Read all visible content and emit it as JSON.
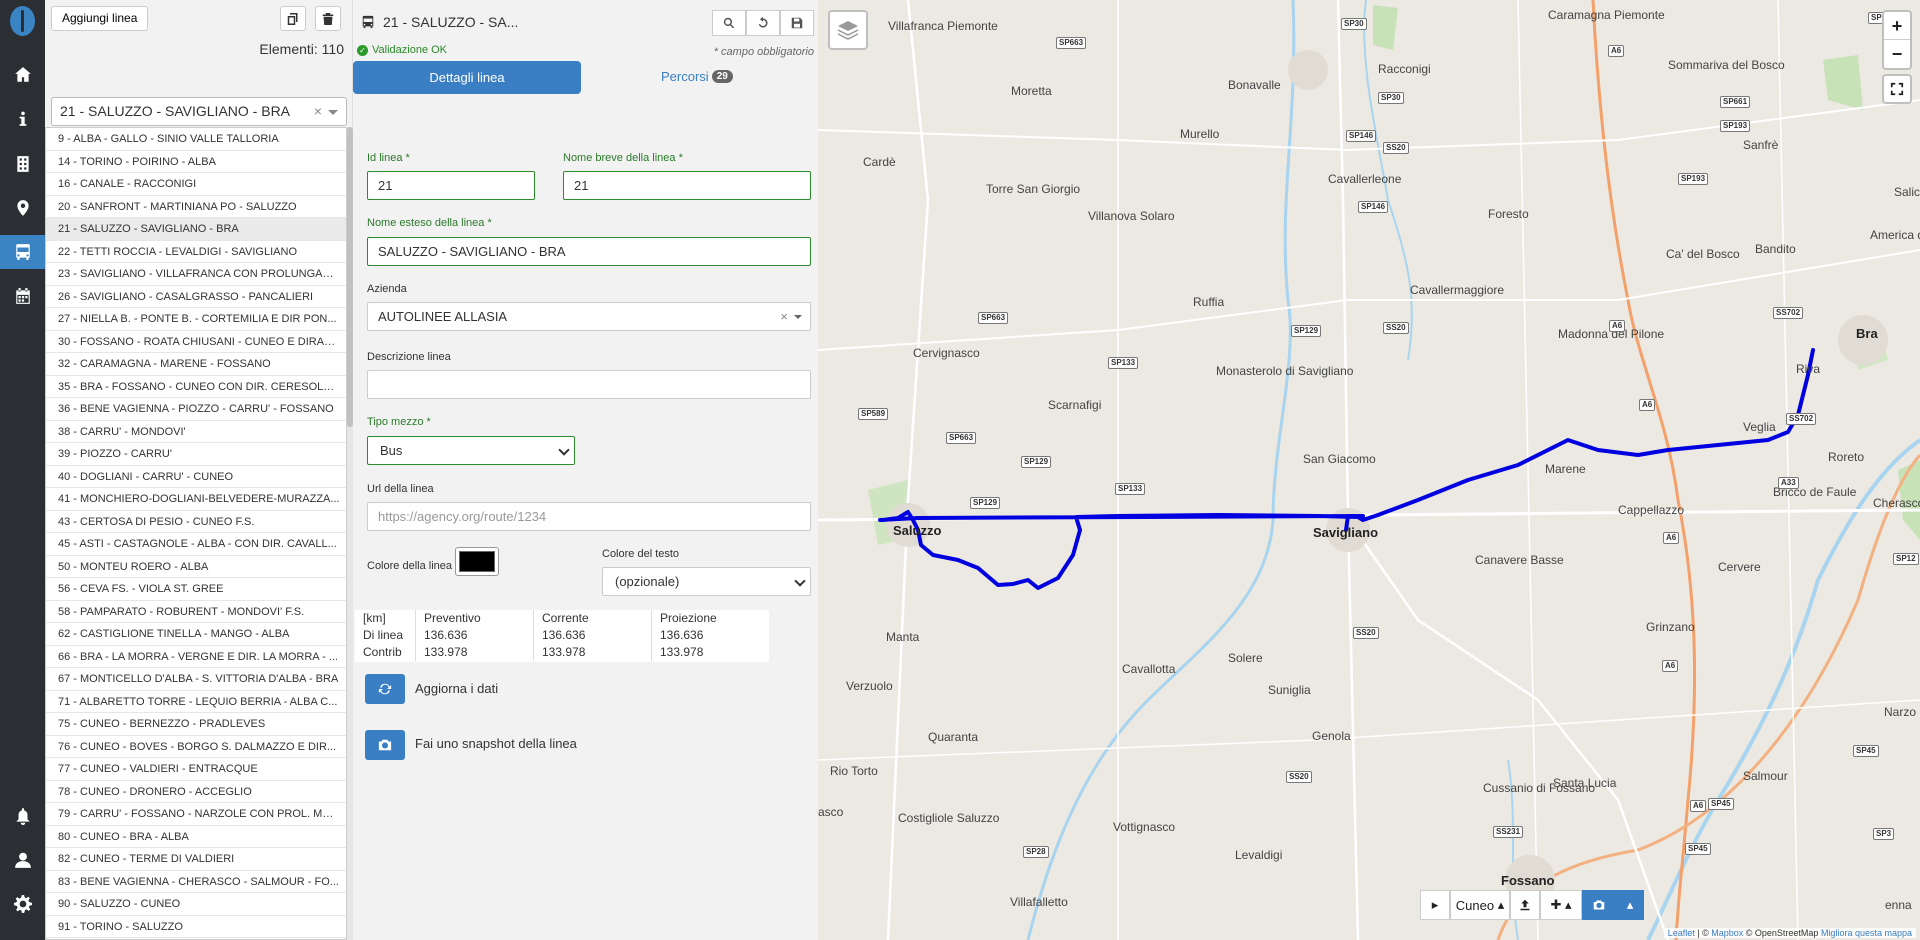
{
  "sidebar": {
    "items": [
      {
        "icon": "home-icon"
      },
      {
        "icon": "info-icon"
      },
      {
        "icon": "building-icon"
      },
      {
        "icon": "map-marker-icon"
      },
      {
        "icon": "bus-icon",
        "active": true
      },
      {
        "icon": "calendar-icon"
      },
      {
        "icon": "bell-icon"
      },
      {
        "icon": "user-icon"
      },
      {
        "icon": "gear-icon"
      }
    ]
  },
  "list": {
    "add_label": "Aggiungi linea",
    "count_label": "Elementi: 110",
    "selected": "21 - SALUZZO - SAVIGLIANO - BRA",
    "clear": "×",
    "items": [
      "9 - ALBA - GALLO - SINIO VALLE TALLORIA",
      "14 - TORINO - POIRINO - ALBA",
      "16 - CANALE - RACCONIGI",
      "20 - SANFRONT - MARTINIANA PO - SALUZZO",
      "21 - SALUZZO - SAVIGLIANO - BRA",
      "22 - TETTI ROCCIA - LEVALDIGI - SAVIGLIANO",
      "23 - SAVIGLIANO - VILLAFRANCA CON PROLUNGAM...",
      "26 - SAVIGLIANO - CASALGRASSO - PANCALIERI",
      "27 - NIELLA B. - PONTE B. - CORTEMILIA E DIR PON...",
      "30 - FOSSANO - ROATA CHIUSANI - CUNEO E DIRAM...",
      "32 - CARAMAGNA - MARENE - FOSSANO",
      "35 - BRA - FOSSANO - CUNEO CON DIR. CERESOLE ...",
      "36 - BENE VAGIENNA - PIOZZO - CARRU' - FOSSANO",
      "38 - CARRU' - MONDOVI'",
      "39 - PIOZZO - CARRU'",
      "40 - DOGLIANI - CARRU' - CUNEO",
      "41 - MONCHIERO-DOGLIANI-BELVEDERE-MURAZZA...",
      "43 - CERTOSA DI PESIO - CUNEO F.S.",
      "45 - ASTI - CASTAGNOLE - ALBA - CON DIR. CAVALL...",
      "50 - MONTEU ROERO - ALBA",
      "56 - CEVA FS. - VIOLA ST. GREE",
      "58 - PAMPARATO - ROBURENT - MONDOVI' F.S.",
      "62 - CASTIGLIONE TINELLA - MANGO - ALBA",
      "66 - BRA - LA MORRA - VERGNE E DIR. LA MORRA - ...",
      "67 - MONTICELLO D'ALBA - S. VITTORIA D'ALBA - BRA",
      "71 - ALBARETTO TORRE - LEQUIO BERRIA - ALBA C...",
      "75 - CUNEO - BERNEZZO - PRADLEVES",
      "76 - CUNEO - BOVES - BORGO S. DALMAZZO E DIR...",
      "77 - CUNEO - VALDIERI - ENTRACQUE",
      "78 - CUNEO - DRONERO - ACCEGLIO",
      "79 - CARRU' - FOSSANO - NARZOLE CON PROL. MO...",
      "80 - CUNEO - BRA - ALBA",
      "82 - CUNEO - TERME DI VALDIERI",
      "83 - BENE VAGIENNA - CHERASCO - SALMOUR - FO...",
      "90 - SALUZZO - CUNEO",
      "91 - TORINO - SALUZZO"
    ]
  },
  "detail": {
    "title": "21 - SALUZZO - SA...",
    "validation": "Validazione OK",
    "required_note": "* campo obbligatorio",
    "tab_details": "Dettagli linea",
    "tab_routes": "Percorsi",
    "routes_count": "29",
    "id_label": "Id linea *",
    "id_value": "21",
    "short_label": "Nome breve della linea *",
    "short_value": "21",
    "long_label": "Nome esteso della linea *",
    "long_value": "SALUZZO - SAVIGLIANO - BRA",
    "agency_label": "Azienda",
    "agency_value": "AUTOLINEE ALLASIA",
    "desc_label": "Descrizione linea",
    "desc_value": "",
    "vehicle_label": "Tipo mezzo *",
    "vehicle_value": "Bus",
    "url_label": "Url della linea",
    "url_placeholder": "https://agency.org/route/1234",
    "color_label": "Colore della linea",
    "line_color": "#000000",
    "textcolor_label": "Colore del testo",
    "textcolor_value": "(opzionale)",
    "stats": {
      "headers": [
        "[km]",
        "Preventivo",
        "Corrente",
        "Proiezione"
      ],
      "rows": [
        [
          "Di linea",
          "136.636",
          "136.636",
          "136.636"
        ],
        [
          "Contrib",
          "133.978",
          "133.978",
          "133.978"
        ]
      ]
    },
    "refresh_label": "Aggiorna i dati",
    "snapshot_label": "Fai uno snapshot della linea"
  },
  "map": {
    "route_color": "#0000e0",
    "places": [
      "Villafranca Piemonte",
      "Moretta",
      "Cardè",
      "Torre San Giorgio",
      "Villanova Solaro",
      "Murello",
      "Racconigi",
      "Bonavalle",
      "Caramagna Piemonte",
      "Sommariva del Bosco",
      "Sanfrè",
      "Cavallerleone",
      "Foresto",
      "Ca' del Bosco",
      "Bandito",
      "America dei Boschi",
      "Salic",
      "Ruffia",
      "Cavallermaggiore",
      "Cervignasco",
      "Scarnafigi",
      "Monasterolo di Savigliano",
      "Madonna del Pilone",
      "Riva",
      "Bra",
      "Veglia",
      "Roreto",
      "San Giacomo",
      "Marene",
      "Bricco de Faule",
      "Cherasco",
      "Cappellazzo",
      "Saluzzo",
      "Savigliano",
      "Canavere Basse",
      "Cervere",
      "Manta",
      "Verzuolo",
      "Cavallotta",
      "Solere",
      "Suniglia",
      "Grinzano",
      "Narzo",
      "Quaranta",
      "Rio Torto",
      "Genola",
      "Salmour",
      "Costigliole Saluzzo",
      "Vottignasco",
      "Cussanio di Fossano",
      "Santa Lucia",
      "Levaldigi",
      "Villafalletto",
      "Fossano",
      "enna",
      "asco"
    ],
    "toolbar": {
      "region": "Cuneo"
    },
    "attribution": {
      "leaflet": "Leaflet",
      "sep": " | © ",
      "mapbox": "Mapbox",
      "osm": " © OpenStreetMap ",
      "improve": "Migliora questa mappa"
    }
  }
}
